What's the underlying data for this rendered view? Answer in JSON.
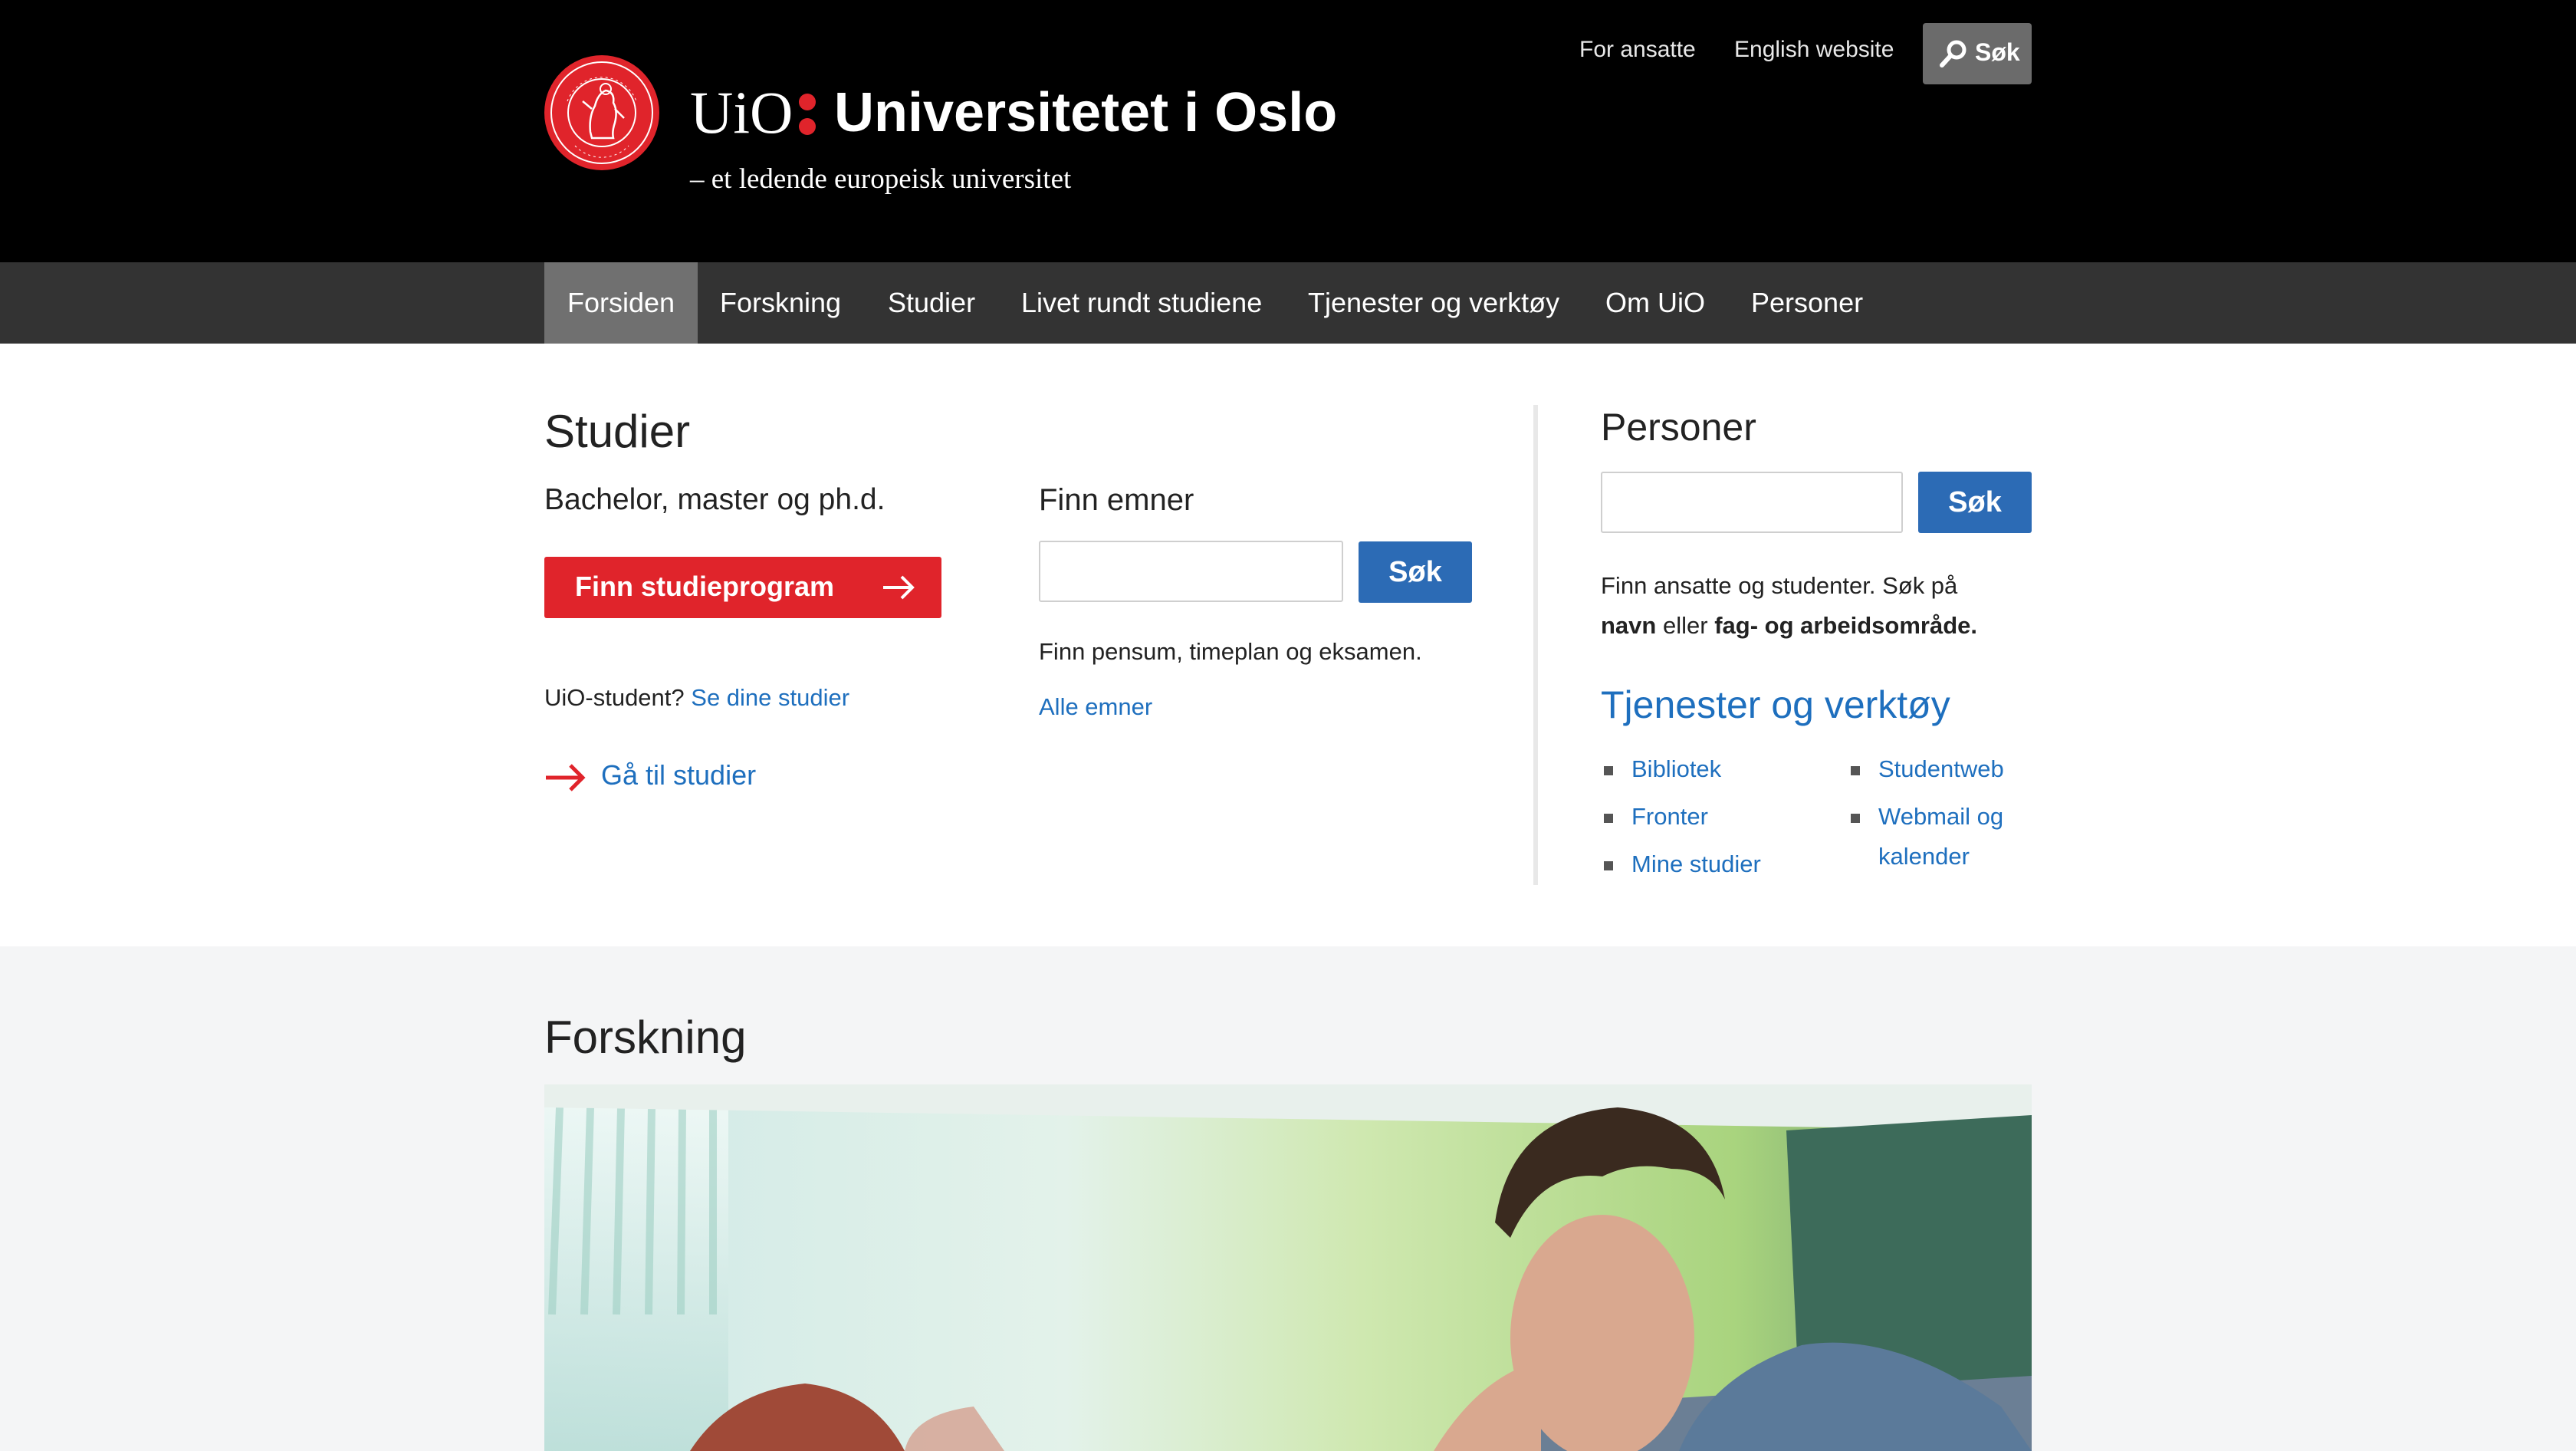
{
  "header": {
    "logo_text": "UiO",
    "university_name": "Universitetet i Oslo",
    "tagline": "– et ledende europeisk universitet",
    "links": [
      "For ansatte",
      "English website"
    ],
    "search_label": "Søk",
    "seal_label": "UNIVERSITAS OSLOENSIS MDCCCXI"
  },
  "nav": {
    "items": [
      "Forsiden",
      "Forskning",
      "Studier",
      "Livet rundt studiene",
      "Tjenester og verktøy",
      "Om UiO",
      "Personer"
    ],
    "active": "Forsiden"
  },
  "studier": {
    "heading": "Studier",
    "subheading": "Bachelor, master og ph.d.",
    "button": "Finn studieprogram",
    "student_question": "UiO-student?",
    "student_link": "Se dine studier",
    "goto_link": "Gå til studier"
  },
  "emner": {
    "heading": "Finn emner",
    "search_button": "Søk",
    "input_value": "",
    "description": "Finn pensum, timeplan og eksamen.",
    "all_link": "Alle emner"
  },
  "personer": {
    "heading": "Personer",
    "search_button": "Søk",
    "input_value": "",
    "desc_part1": "Finn ansatte og studenter. Søk på",
    "desc_bold1": "navn",
    "desc_part2": "eller",
    "desc_bold2": "fag- og arbeidsområde."
  },
  "tjenester": {
    "heading": "Tjenester og verktøy",
    "col1": [
      "Bibliotek",
      "Fronter",
      "Mine studier"
    ],
    "col2": [
      "Studentweb",
      "Webmail og kalender"
    ]
  },
  "forskning": {
    "heading": "Forskning"
  },
  "colors": {
    "header_bg": "#000000",
    "nav_bg": "#333333",
    "nav_active": "#707070",
    "brand_red": "#e0242b",
    "link_blue": "#1e6fbe",
    "button_blue": "#2c6bb5",
    "band_bg": "#f4f5f6"
  },
  "icons": [
    "search-icon",
    "arrow-right-icon",
    "uio-seal-icon"
  ]
}
